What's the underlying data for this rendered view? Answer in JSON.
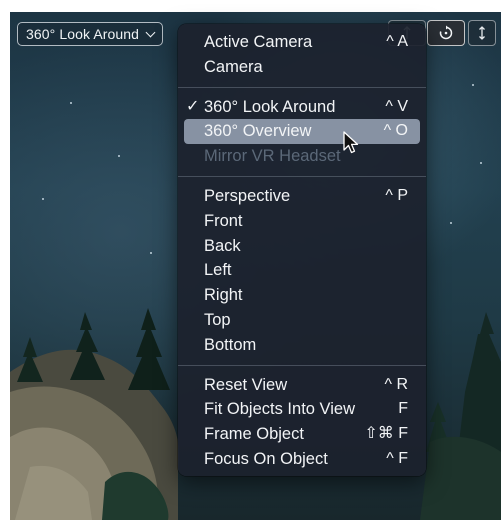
{
  "viewport": {
    "popup_label": "360° Look Around"
  },
  "menu": {
    "groups": [
      {
        "items": [
          {
            "label": "Active Camera",
            "shortcut": "^ A",
            "checked": false,
            "disabled": false,
            "highlighted": false
          },
          {
            "label": "Camera",
            "shortcut": "",
            "checked": false,
            "disabled": false,
            "highlighted": false
          }
        ]
      },
      {
        "items": [
          {
            "label": "360° Look Around",
            "shortcut": "^ V",
            "checked": true,
            "disabled": false,
            "highlighted": false
          },
          {
            "label": "360° Overview",
            "shortcut": "^ O",
            "checked": false,
            "disabled": false,
            "highlighted": true
          },
          {
            "label": "Mirror VR Headset",
            "shortcut": "",
            "checked": false,
            "disabled": true,
            "highlighted": false
          }
        ]
      },
      {
        "items": [
          {
            "label": "Perspective",
            "shortcut": "^ P",
            "checked": false,
            "disabled": false,
            "highlighted": false
          },
          {
            "label": "Front",
            "shortcut": "",
            "checked": false,
            "disabled": false,
            "highlighted": false
          },
          {
            "label": "Back",
            "shortcut": "",
            "checked": false,
            "disabled": false,
            "highlighted": false
          },
          {
            "label": "Left",
            "shortcut": "",
            "checked": false,
            "disabled": false,
            "highlighted": false
          },
          {
            "label": "Right",
            "shortcut": "",
            "checked": false,
            "disabled": false,
            "highlighted": false
          },
          {
            "label": "Top",
            "shortcut": "",
            "checked": false,
            "disabled": false,
            "highlighted": false
          },
          {
            "label": "Bottom",
            "shortcut": "",
            "checked": false,
            "disabled": false,
            "highlighted": false
          }
        ]
      },
      {
        "items": [
          {
            "label": "Reset View",
            "shortcut": "^ R",
            "checked": false,
            "disabled": false,
            "highlighted": false
          },
          {
            "label": "Fit Objects Into View",
            "shortcut": "F",
            "checked": false,
            "disabled": false,
            "highlighted": false
          },
          {
            "label": "Frame Object",
            "shortcut": "⇧⌘ F",
            "checked": false,
            "disabled": false,
            "highlighted": false
          },
          {
            "label": "Focus On Object",
            "shortcut": "^ F",
            "checked": false,
            "disabled": false,
            "highlighted": false
          }
        ]
      }
    ],
    "check_glyph": "✓"
  },
  "colors": {
    "menu_background": "#1c212d",
    "highlight": "#8792a3",
    "disabled_text": "#5b6878"
  },
  "icons": {
    "popup_chevron": "chevron-down-icon",
    "rotate_tool": "rotate-icon",
    "cursor": "pointer-cursor-icon"
  }
}
